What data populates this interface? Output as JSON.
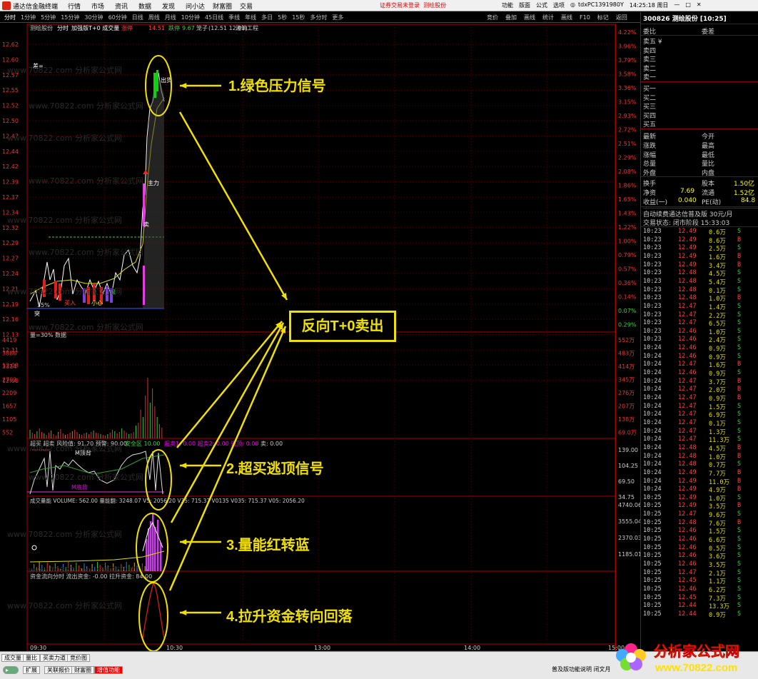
{
  "titlebar": {
    "app_title": "通达信金融终端",
    "menu": [
      "行情",
      "市场",
      "资讯",
      "数据",
      "发现",
      "问小达",
      "财富圈",
      "交易"
    ],
    "warning": "证券交易未登录",
    "test_label": "测绘股份",
    "right_items": [
      "功能",
      "版面",
      "公式",
      "选项"
    ],
    "account": "tdxPC1391980Y",
    "clock": "14:25:18 周日"
  },
  "periodbar": {
    "items": [
      "分时",
      "1分钟",
      "5分钟",
      "15分钟",
      "30分钟",
      "60分钟",
      "日线",
      "周线",
      "月线",
      "10分钟",
      "45日线",
      "季线",
      "年线",
      "多日",
      "5秒",
      "15秒",
      "多分时",
      "更多"
    ],
    "selected": "分时"
  },
  "rightbar": [
    "竞价",
    "叠加",
    "画线",
    "统计",
    "画线",
    "F10",
    "标记",
    "返回"
  ],
  "chart": {
    "header": {
      "stock": "测绘股份",
      "mode": "分时",
      "indicator": "加强版T+0 成交量",
      "limit_label": "涨停",
      "up_price": "14.51",
      "down_label": "跌停",
      "down_price": "9.67",
      "bar_label": "笼子",
      "range": "(12.51 12.01)",
      "sector": "建筑工程"
    },
    "price_ticks": [
      "12.62",
      "12.60",
      "12.57",
      "12.55",
      "12.52",
      "12.50",
      "12.47",
      "12.44",
      "12.42",
      "12.39",
      "12.37",
      "12.34",
      "12.32",
      "12.29",
      "12.27",
      "12.24",
      "12.21",
      "12.19",
      "12.16",
      "12.13",
      "12.11",
      "12.08",
      "12.06"
    ],
    "pct_ticks": [
      "4.22%",
      "3.96%",
      "3.79%",
      "3.58%",
      "3.36%",
      "3.15%",
      "2.93%",
      "2.72%",
      "2.51%",
      "2.29%",
      "2.08%",
      "1.86%",
      "1.65%",
      "1.43%",
      "1.22%",
      "1.00%",
      "0.79%",
      "0.57%",
      "0.36%",
      "0.14%",
      "0.07%",
      "0.29%"
    ],
    "price_labels": {
      "sell_label": "出货",
      "main_label": "主力",
      "buy_label": "买入",
      "small_label": "小心",
      "green_badge": "绿",
      "pct_label": "35%",
      "mark_buy": "突",
      "mark_sell": "卖",
      "head_label": "差="
    },
    "volume_header": "量=30% 数据",
    "volume_ticks": [
      "4419",
      "3886",
      "3314",
      "2762",
      "2209",
      "1657",
      "1105",
      "552"
    ],
    "volume_right_ticks": [
      "552万",
      "483万",
      "414万",
      "345万",
      "276万",
      "207万",
      "138万",
      "69.0万"
    ],
    "ind1": {
      "header": "超买 超卖  风险值: 91.20  预警: 90.00",
      "header_safe": "安全区 10.00",
      "header_b": "超卖1: 0.00  超卖2: 0.00  逃顶: 0.00",
      "header_c": "卖: 0.00",
      "right_ticks": [
        "139.00",
        "104.25",
        "69.50",
        "34.75"
      ],
      "top_label": "M顶背",
      "bottom_label": "M底背"
    },
    "ind2": {
      "header": "成交量能  VOLUME: 562.00  量能翻: 3248.07  V5: 2056.20  V35: 715.37  V0135  V035: 715.37  V05: 2056.20",
      "right_ticks": [
        "4740.06",
        "3555.04",
        "2370.03",
        "1185.01"
      ]
    },
    "ind3": {
      "header": "资金流向分时  流出资金: -0.00  拉升资金: 84.00"
    },
    "time_labels": [
      "09:30",
      "10:30",
      "13:00",
      "14:00",
      "15:00"
    ],
    "watermark": "www.70822.com 分析家公式网"
  },
  "callouts": {
    "c1": "1.绿色压力信号",
    "c2": "2.超买逃顶信号",
    "c3": "3.量能红转蓝",
    "c4": "4.拉升资金转向回落",
    "center": "反向T+0卖出"
  },
  "quote": {
    "title": "300826 测绘股份 [10:25]",
    "weibi": "委比",
    "weicha": "委差",
    "asks": [
      "卖五 ¥",
      "卖四",
      "卖三",
      "卖二",
      "卖一"
    ],
    "bids": [
      "买一",
      "买二",
      "买三",
      "买四",
      "买五"
    ],
    "stats_left": [
      "最新",
      "涨跌",
      "涨幅",
      "总量",
      "外盘"
    ],
    "stats_right": [
      "今开",
      "最高",
      "最低",
      "量比",
      "内盘"
    ],
    "huanshou": "换手",
    "guben": "股本",
    "guben_val": "1.50亿",
    "jingzi": "净资",
    "jingzi_val": "7.69",
    "liutong": "流通",
    "liutong_val": "1.52亿",
    "shouyi": "收益(一)",
    "shouyi_val": "0.040",
    "pe": "PE(动)",
    "pe_val": "84.8",
    "notice": "自动续费通达信普及版 30元/月",
    "status": "交易状态: 闭市阶段 15:33:03",
    "ticks": [
      [
        "10:23",
        "12.49",
        "0.6万",
        "S"
      ],
      [
        "10:23",
        "12.49",
        "8.6万",
        "B"
      ],
      [
        "10:23",
        "12.49",
        "2.5万",
        "S"
      ],
      [
        "10:23",
        "12.49",
        "1.6万",
        "B"
      ],
      [
        "10:23",
        "12.49",
        "3.4万",
        "B"
      ],
      [
        "10:23",
        "12.48",
        "4.5万",
        "S"
      ],
      [
        "10:23",
        "12.48",
        "5.4万",
        "S"
      ],
      [
        "10:23",
        "12.48",
        "0.1万",
        "S"
      ],
      [
        "10:23",
        "12.48",
        "1.0万",
        "B"
      ],
      [
        "10:23",
        "12.47",
        "1.4万",
        "S"
      ],
      [
        "10:23",
        "12.47",
        "2.2万",
        "S"
      ],
      [
        "10:23",
        "12.47",
        "6.5万",
        "S"
      ],
      [
        "10:23",
        "12.46",
        "1.0万",
        "S"
      ],
      [
        "10:23",
        "12.46",
        "2.4万",
        "S"
      ],
      [
        "10:24",
        "12.46",
        "0.9万",
        "S"
      ],
      [
        "10:24",
        "12.46",
        "0.9万",
        "S"
      ],
      [
        "10:24",
        "12.47",
        "1.6万",
        "B"
      ],
      [
        "10:24",
        "12.46",
        "0.9万",
        "S"
      ],
      [
        "10:24",
        "12.47",
        "3.7万",
        "B"
      ],
      [
        "10:24",
        "12.47",
        "2.0万",
        "B"
      ],
      [
        "10:24",
        "12.47",
        "0.9万",
        "B"
      ],
      [
        "10:24",
        "12.47",
        "1.5万",
        "S"
      ],
      [
        "10:24",
        "12.47",
        "6.9万",
        "S"
      ],
      [
        "10:24",
        "12.47",
        "0.1万",
        "S"
      ],
      [
        "10:24",
        "12.47",
        "1.3万",
        "S"
      ],
      [
        "10:24",
        "12.47",
        "11.3万",
        "S"
      ],
      [
        "10:24",
        "12.48",
        "4.5万",
        "B"
      ],
      [
        "10:24",
        "12.48",
        "1.0万",
        "B"
      ],
      [
        "10:24",
        "12.48",
        "0.7万",
        "S"
      ],
      [
        "10:24",
        "12.49",
        "7.7万",
        "B"
      ],
      [
        "10:24",
        "12.49",
        "11.0万",
        "B"
      ],
      [
        "10:24",
        "12.49",
        "4.9万",
        "B"
      ],
      [
        "10:25",
        "12.49",
        "1.0万",
        "S"
      ],
      [
        "10:25",
        "12.49",
        "3.5万",
        "B"
      ],
      [
        "10:25",
        "12.47",
        "9.6万",
        "S"
      ],
      [
        "10:25",
        "12.48",
        "7.6万",
        "B"
      ],
      [
        "10:25",
        "12.46",
        "1.5万",
        "S"
      ],
      [
        "10:25",
        "12.46",
        "6.6万",
        "S"
      ],
      [
        "10:25",
        "12.46",
        "0.5万",
        "S"
      ],
      [
        "10:25",
        "12.46",
        "3.6万",
        "S"
      ],
      [
        "10:25",
        "12.46",
        "3.5万",
        "S"
      ],
      [
        "10:25",
        "12.47",
        "2.1万",
        "S"
      ],
      [
        "10:25",
        "12.45",
        "1.1万",
        "S"
      ],
      [
        "10:25",
        "12.46",
        "6.2万",
        "S"
      ],
      [
        "10:25",
        "12.45",
        "7.3万",
        "S"
      ],
      [
        "10:25",
        "12.44",
        "13.3万",
        "S"
      ],
      [
        "10:25",
        "12.44",
        "0.9万",
        "S"
      ]
    ]
  },
  "bottom": {
    "tabs1": [
      "成交量",
      "量比",
      "买卖力道",
      "竞价图"
    ],
    "tabs2": [
      "扩展",
      "关联报价",
      "财富圈",
      "增值功能"
    ],
    "status_right": "普及版功能说明 闭文月"
  },
  "brand": {
    "name": "分析家公式网",
    "url": "www.70822.com"
  },
  "colors": {
    "up": "#ff3030",
    "down": "#00c000",
    "axis": "#b00000",
    "price_line": "#ffffff",
    "avg_line": "#e0e000",
    "callout": "#f0e000"
  }
}
